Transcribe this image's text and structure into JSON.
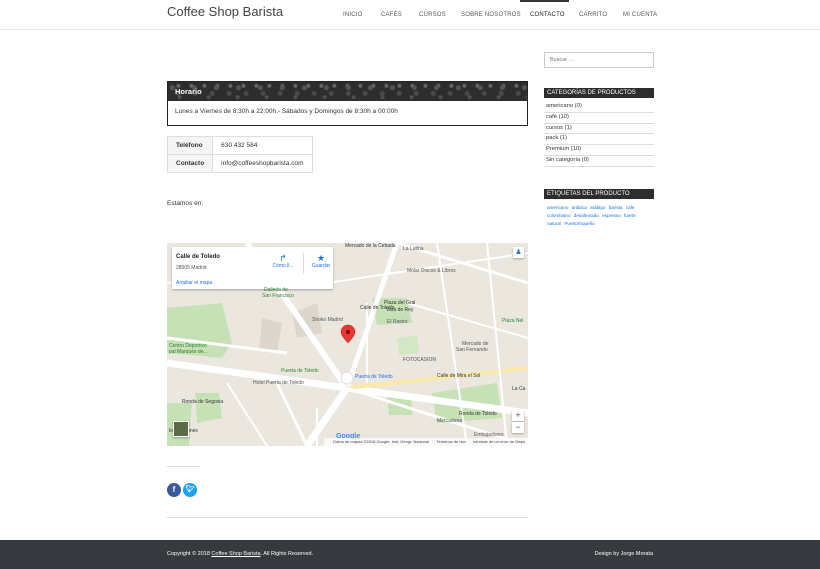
{
  "site": {
    "title": "Coffee Shop Barista"
  },
  "nav": {
    "items": [
      "INICIO",
      "CAFÉS",
      "CURSOS",
      "SOBRE NOSOTROS",
      "CONTACTO",
      "CARRITO",
      "MI CUENTA"
    ],
    "active": "CONTACTO"
  },
  "horario": {
    "title": "Horario",
    "text": "Lunes a Viernes de 8:30h a 22:00h.- Sábados y Domingos de 8:30h a 00:00h"
  },
  "contact": {
    "phone_label": "Teléfono",
    "phone": "630 432 584",
    "contact_label": "Contacto",
    "email": "info@coffeeshopbarista.com"
  },
  "estamos": "Estamos en:",
  "map": {
    "place_title": "Calle de Toledo",
    "place_sub": "28005 Madrid",
    "expand_link": "Ampliar el mapa",
    "directions_label": "Cómo ll...",
    "save_label": "Guardar",
    "labels": {
      "cebada": "Mercado de la Cebada",
      "latina": "La Latina",
      "molar": "Molar Discos & Libros",
      "dalieda": "Dalieda de",
      "san_francisco": "San Francisco",
      "plaza_gral": "Plaza del Gral",
      "vara_rey": "Vara de Rey",
      "shoko": "Shoko Madrid",
      "rastro": "El Rastro",
      "nelo": "Plaza Nel",
      "fotocasion": "FOTOCASION",
      "mercado_sf": "Mercado de",
      "san_fernando": "San Fernando",
      "centro": "Centro Deportivo",
      "marques": "pal Marqués de...",
      "puerta": "Puerta de Toledo",
      "puerta2": "Puerta de Toledo",
      "hotel": "Hotel Puerta de Toledo",
      "mercadona": "Mercadona",
      "ronda_toledo": "Ronda de Toledo",
      "ronda_segovia": "Ronda de Segovia",
      "embajadores": "Embajadores",
      "calle_toledo": "Calle de Toledo",
      "calle_mira": "Calle de Mira el Sol",
      "pontones": "los Pontones",
      "la_ca": "La Ca"
    },
    "google": "Google",
    "footer_data": "Datos de mapas ©2018 Google, Inst. Geogr. Nacional",
    "footer_terms": "Términos de uso",
    "footer_report": "Informar de un error de Maps"
  },
  "sidebar": {
    "search_placeholder": "Buscar ...",
    "categories_title": "CATEGORÍAS DE PRODUCTOS",
    "categories": [
      "americano  (0)",
      "café  (10)",
      "cursos  (1)",
      "pack  (1)",
      "Premium  (10)",
      "Sin categoría  (0)"
    ],
    "tags_title": "ETIQUETAS DEL PRODUCTO",
    "tags": [
      "americano",
      "arábica",
      "arábigo",
      "barista",
      "cafe",
      "colombiano",
      "desafeinado",
      "espresso",
      "fuerte",
      "natural",
      "Puertorriqueño"
    ]
  },
  "footer": {
    "copyright_prefix": "Copyright © 2018 ",
    "copyright_link": "Coffee Shop Barista",
    "copyright_suffix": ". All Rights Reserved.",
    "design": "Design by Jorge Morata"
  },
  "colors": {
    "dark": "#2d2d2d",
    "footer": "#36393d",
    "link": "#1a73e8",
    "facebook": "#3b5998",
    "twitter": "#1da1f2",
    "map_pin": "#e53935"
  }
}
